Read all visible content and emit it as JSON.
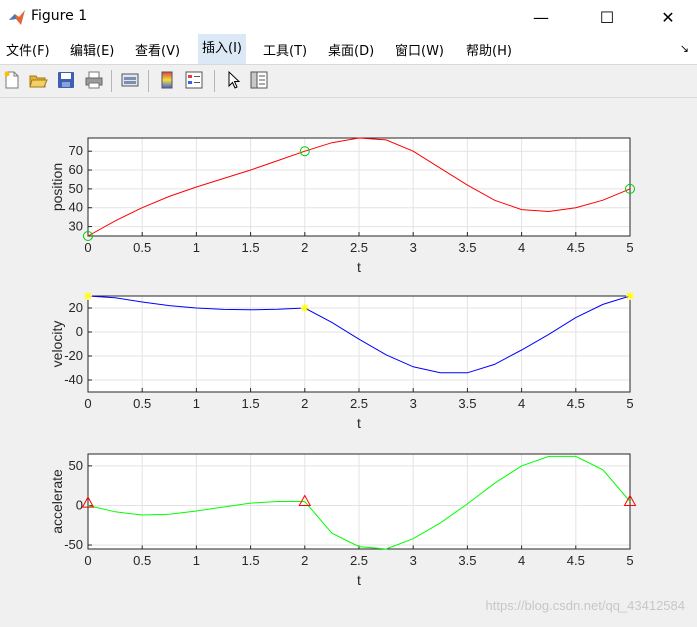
{
  "window": {
    "title": "Figure 1",
    "minimize": "—",
    "maximize": "☐",
    "close": "✕"
  },
  "menu": {
    "items": [
      "文件(F)",
      "编辑(E)",
      "查看(V)",
      "插入(I)",
      "工具(T)",
      "桌面(D)",
      "窗口(W)",
      "帮助(H)"
    ],
    "active_index": 3,
    "dock_arrow": "↘"
  },
  "toolbar": {
    "icons": [
      "new-figure-icon",
      "open-file-icon",
      "save-icon",
      "print-icon",
      "link-plot-icon",
      "insert-colorbar-icon",
      "insert-legend-icon",
      "pointer-icon",
      "property-editor-icon"
    ]
  },
  "watermark": "https://blog.csdn.net/qq_43412584",
  "chart_data": [
    {
      "type": "line",
      "xlabel": "t",
      "ylabel": "position",
      "xlim": [
        0,
        5
      ],
      "ylim": [
        25,
        77
      ],
      "xticks": [
        "0",
        "0.5",
        "1",
        "1.5",
        "2",
        "2.5",
        "3",
        "3.5",
        "4",
        "4.5",
        "5"
      ],
      "yticks": [
        30,
        40,
        50,
        60,
        70
      ],
      "grid": true,
      "color": "#ff0000",
      "x": [
        0,
        0.25,
        0.5,
        0.75,
        1,
        1.25,
        1.5,
        1.75,
        2,
        2.25,
        2.5,
        2.75,
        3,
        3.25,
        3.5,
        3.75,
        4,
        4.25,
        4.5,
        4.75,
        5
      ],
      "y": [
        25,
        33,
        40,
        46,
        51,
        55.5,
        60,
        65,
        70,
        74.5,
        77,
        76,
        70,
        61,
        52,
        44,
        39,
        38,
        40,
        44,
        50
      ],
      "markers": {
        "x": [
          0,
          2,
          5
        ],
        "y": [
          25,
          70,
          50
        ],
        "symbol": "circle",
        "color": "#00cc00"
      }
    },
    {
      "type": "line",
      "xlabel": "t",
      "ylabel": "velocity",
      "xlim": [
        0,
        5
      ],
      "ylim": [
        -50,
        30
      ],
      "xticks": [
        "0",
        "0.5",
        "1",
        "1.5",
        "2",
        "2.5",
        "3",
        "3.5",
        "4",
        "4.5",
        "5"
      ],
      "yticks": [
        20,
        0,
        -20,
        -40
      ],
      "grid": true,
      "color": "#0000ff",
      "x": [
        0,
        0.25,
        0.5,
        0.75,
        1,
        1.25,
        1.5,
        1.75,
        2,
        2.25,
        2.5,
        2.75,
        3,
        3.25,
        3.5,
        3.75,
        4,
        4.25,
        4.5,
        4.75,
        5
      ],
      "y": [
        30,
        28.5,
        25,
        22,
        20,
        18.8,
        18.5,
        19,
        20,
        8,
        -6,
        -19,
        -29,
        -34,
        -34,
        -27,
        -15,
        -2,
        12,
        23,
        30
      ],
      "markers": {
        "x": [
          0,
          2,
          5
        ],
        "y": [
          30,
          20,
          30
        ],
        "symbol": "star",
        "color": "#ffff00"
      }
    },
    {
      "type": "line",
      "xlabel": "t",
      "ylabel": "accelerate",
      "xlim": [
        0,
        5
      ],
      "ylim": [
        -55,
        65
      ],
      "xticks": [
        "0",
        "0.5",
        "1",
        "1.5",
        "2",
        "2.5",
        "3",
        "3.5",
        "4",
        "4.5",
        "5"
      ],
      "yticks": [
        50,
        0,
        -50
      ],
      "grid": true,
      "color": "#00ff00",
      "x": [
        0,
        0.25,
        0.5,
        0.75,
        1,
        1.25,
        1.5,
        1.75,
        2,
        2.25,
        2.5,
        2.75,
        3,
        3.25,
        3.5,
        3.75,
        4,
        4.25,
        4.5,
        4.75,
        5
      ],
      "y": [
        0,
        -8,
        -12,
        -11,
        -7,
        -2,
        3,
        5,
        5,
        -35,
        -52,
        -55,
        -42,
        -22,
        2,
        28,
        50,
        62,
        62,
        45,
        5
      ],
      "markers": {
        "x": [
          0,
          2,
          5
        ],
        "y": [
          3,
          5,
          5
        ],
        "symbol": "triangle",
        "color": "#ff0000"
      }
    }
  ]
}
